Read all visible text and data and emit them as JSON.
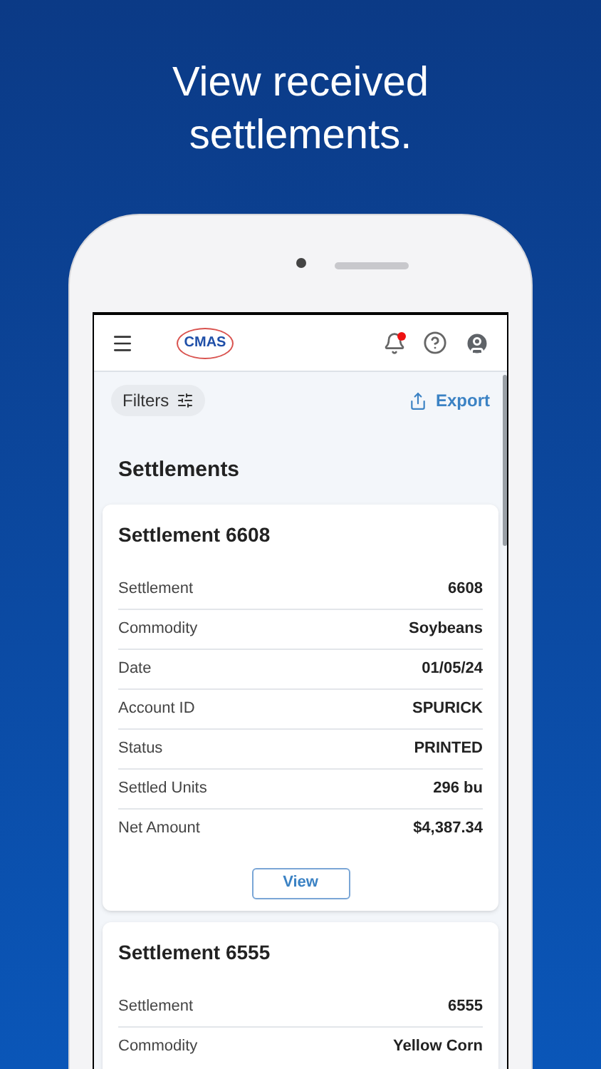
{
  "headline": "View received settlements.",
  "app_bar": {
    "logo_text": "CMAS",
    "has_notification": true
  },
  "toolbar": {
    "filters_label": "Filters",
    "export_label": "Export"
  },
  "page_title": "Settlements",
  "settlements": [
    {
      "title": "Settlement 6608",
      "rows": [
        {
          "label": "Settlement",
          "value": "6608"
        },
        {
          "label": "Commodity",
          "value": "Soybeans"
        },
        {
          "label": "Date",
          "value": "01/05/24"
        },
        {
          "label": "Account ID",
          "value": "SPURICK"
        },
        {
          "label": "Status",
          "value": "PRINTED"
        },
        {
          "label": "Settled Units",
          "value": "296 bu"
        },
        {
          "label": "Net Amount",
          "value": "$4,387.34"
        }
      ],
      "button": "View"
    },
    {
      "title": "Settlement 6555",
      "rows": [
        {
          "label": "Settlement",
          "value": "6555"
        },
        {
          "label": "Commodity",
          "value": "Yellow Corn"
        }
      ]
    }
  ]
}
